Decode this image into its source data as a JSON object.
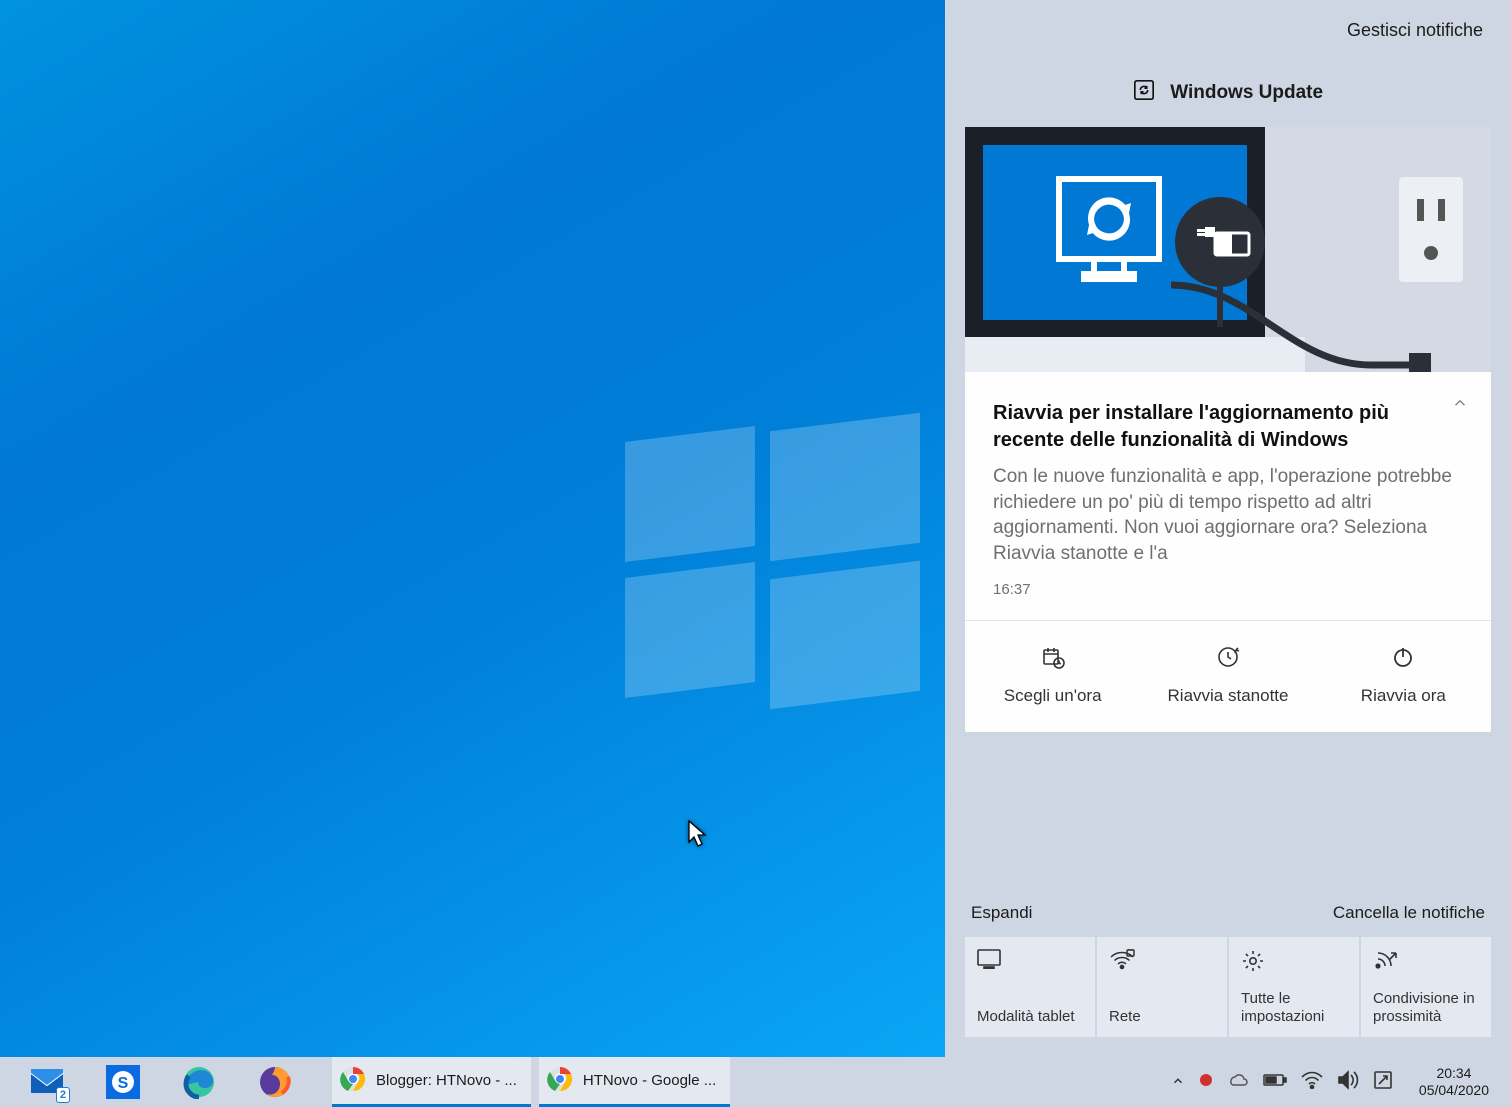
{
  "action_center": {
    "manage": "Gestisci notifiche",
    "header": "Windows Update",
    "notification": {
      "title": "Riavvia per installare l'aggiornamento più recente delle funzionalità di Windows",
      "body": "Con le nuove funzionalità e app, l'operazione potrebbe richiedere un po' più di tempo rispetto ad altri aggiornamenti. Non vuoi aggiornare ora? Seleziona Riavvia stanotte e l'a",
      "time": "16:37",
      "actions": {
        "pick": "Scegli un'ora",
        "tonight": "Riavvia stanotte",
        "now": "Riavvia ora"
      }
    },
    "expand": "Espandi",
    "clear": "Cancella le notifiche",
    "quick_actions": {
      "tablet": "Modalità tablet",
      "network": "Rete",
      "settings": "Tutte le impostazioni",
      "nearby": "Condivisione in prossimità"
    }
  },
  "taskbar": {
    "mail_badge": "2",
    "apps": {
      "blogger": "Blogger: HTNovo - ...",
      "google": "HTNovo - Google ..."
    },
    "clock": {
      "time": "20:34",
      "date": "05/04/2020"
    }
  }
}
